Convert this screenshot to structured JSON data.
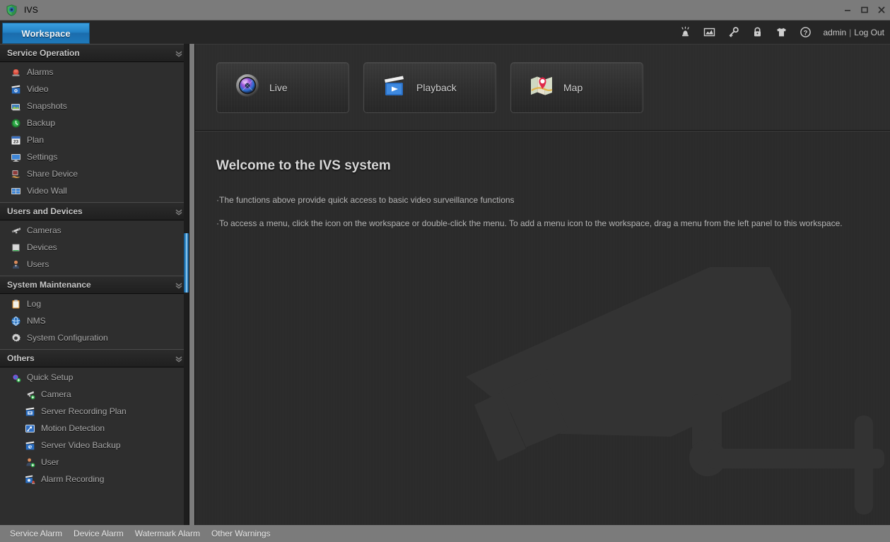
{
  "window": {
    "title": "IVS",
    "app_icon": "shield-icon",
    "controls": {
      "minimize": "minimize-button",
      "maximize": "maximize-button",
      "close": "close-button"
    }
  },
  "tabbar": {
    "active_tab": "Workspace",
    "toolbar_icons": [
      {
        "name": "alarm-siren-icon",
        "title": "Alarm"
      },
      {
        "name": "image-chart-icon",
        "title": "Image"
      },
      {
        "name": "key-icon",
        "title": "Key"
      },
      {
        "name": "lock-icon",
        "title": "Lock"
      },
      {
        "name": "skin-shirt-icon",
        "title": "Skin"
      },
      {
        "name": "help-icon",
        "title": "Help"
      }
    ],
    "user": "admin",
    "separator": "|",
    "logout": "Log Out"
  },
  "sidebar": {
    "sections": [
      {
        "title": "Service Operation",
        "collapse_icon": "chevron-double-down-icon",
        "items": [
          {
            "label": "Alarms",
            "icon": "alarm-light-icon"
          },
          {
            "label": "Video",
            "icon": "video-clapper-icon"
          },
          {
            "label": "Snapshots",
            "icon": "snapshot-image-icon"
          },
          {
            "label": "Backup",
            "icon": "backup-clock-icon"
          },
          {
            "label": "Plan",
            "icon": "calendar-icon"
          },
          {
            "label": "Settings",
            "icon": "monitor-icon"
          },
          {
            "label": "Share Device",
            "icon": "share-device-icon"
          },
          {
            "label": "Video Wall",
            "icon": "video-wall-grid-icon"
          }
        ]
      },
      {
        "title": "Users and Devices",
        "collapse_icon": "chevron-double-down-icon",
        "items": [
          {
            "label": "Cameras",
            "icon": "camera-icon"
          },
          {
            "label": "Devices",
            "icon": "device-box-icon"
          },
          {
            "label": "Users",
            "icon": "user-person-icon"
          }
        ]
      },
      {
        "title": "System Maintenance",
        "collapse_icon": "chevron-double-down-icon",
        "items": [
          {
            "label": "Log",
            "icon": "clipboard-log-icon"
          },
          {
            "label": "NMS",
            "icon": "globe-icon"
          },
          {
            "label": "System Configuration",
            "icon": "gear-icon"
          }
        ]
      },
      {
        "title": "Others",
        "collapse_icon": "chevron-double-down-icon",
        "items": [
          {
            "label": "Quick Setup",
            "icon": "quick-setup-lens-icon",
            "sub": false
          },
          {
            "label": "Camera",
            "icon": "camera-add-icon",
            "sub": true
          },
          {
            "label": "Server Recording Plan",
            "icon": "server-recording-plan-icon",
            "sub": true
          },
          {
            "label": "Motion Detection",
            "icon": "motion-detection-icon",
            "sub": true
          },
          {
            "label": "Server Video Backup",
            "icon": "server-video-backup-icon",
            "sub": true
          },
          {
            "label": "User",
            "icon": "user-add-icon",
            "sub": true
          },
          {
            "label": "Alarm Recording",
            "icon": "alarm-recording-icon",
            "sub": true
          }
        ]
      }
    ]
  },
  "main": {
    "quick_buttons": [
      {
        "label": "Live",
        "icon": "camera-lens-icon"
      },
      {
        "label": "Playback",
        "icon": "playback-film-icon"
      },
      {
        "label": "Map",
        "icon": "map-pin-icon"
      }
    ],
    "welcome": {
      "title": "Welcome to the IVS system",
      "lines": [
        "·The functions above provide quick access to basic video surveillance functions",
        "·To access a menu, click the icon on the workspace or double-click the menu. To add a menu icon to the workspace, drag a menu from the left panel to this workspace."
      ]
    },
    "watermark": "surveillance-camera-watermark"
  },
  "statusbar": {
    "items": [
      "Service Alarm",
      "Device Alarm",
      "Watermark Alarm",
      "Other Warnings"
    ]
  },
  "colors": {
    "accent_blue": "#2281c4",
    "window_chrome": "#7b7b7b",
    "panel_bg": "#2b2b2b",
    "sidebar_bg": "#2e2e2e",
    "text_muted": "#a9a9a9"
  }
}
